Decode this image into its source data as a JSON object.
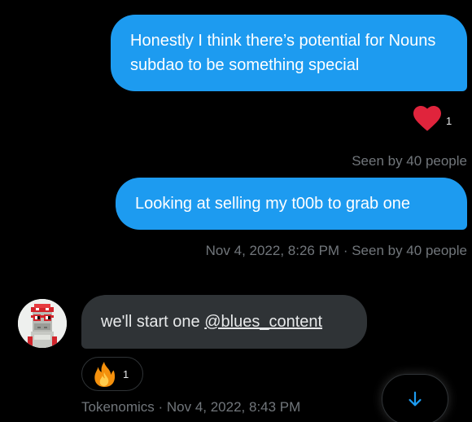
{
  "messages": [
    {
      "text": "Honestly I think there’s potential for Nouns subdao to be something special",
      "reaction_count": "1",
      "status": "Seen by 40 people"
    },
    {
      "text": "Looking at selling my t00b to grab one",
      "timestamp": "Nov 4, 2022, 8:26 PM",
      "separator": " · ",
      "status": "Seen by 40 people"
    },
    {
      "text_prefix": "we'll start one ",
      "mention": "@blues_content",
      "reaction_count": "1",
      "sender": "Tokenomics",
      "separator": " · ",
      "timestamp": "Nov 4, 2022, 8:43 PM"
    }
  ],
  "icons": {
    "reaction_1": "heart-icon",
    "reaction_3": "fire-icon",
    "scroll": "arrow-down-icon",
    "avatar": "pixel-avatar"
  },
  "colors": {
    "outgoing_bubble": "#1d9bf0",
    "incoming_bubble": "#2f3336",
    "heart": "#f91880",
    "meta_text": "#71767b"
  }
}
